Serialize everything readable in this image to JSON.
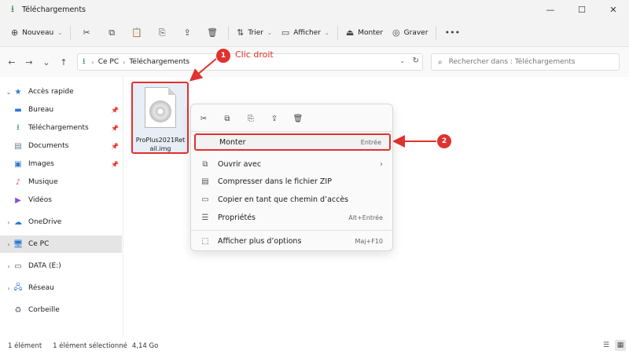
{
  "window": {
    "title": "Téléchargements"
  },
  "toolbar": {
    "new_label": "Nouveau",
    "sort_label": "Trier",
    "view_label": "Afficher",
    "mount_label": "Monter",
    "burn_label": "Graver"
  },
  "address": {
    "crumbs": [
      "Ce PC",
      "Téléchargements"
    ],
    "search_placeholder": "Rechercher dans : Téléchargements"
  },
  "sidebar": {
    "quick_access": "Accès rapide",
    "items": [
      "Bureau",
      "Téléchargements",
      "Documents",
      "Images",
      "Musique",
      "Vidéos"
    ],
    "onedrive": "OneDrive",
    "this_pc": "Ce PC",
    "data_drive": "DATA (E:)",
    "network": "Réseau",
    "recycle": "Corbeille"
  },
  "file": {
    "name": "ProPlus2021Retail.img"
  },
  "annotations": {
    "step1_number": "1",
    "step1_label": "Clic droit",
    "step2_number": "2"
  },
  "context_menu": {
    "items": [
      {
        "label": "Monter",
        "shortcut": "Entrée"
      },
      {
        "label": "Ouvrir avec",
        "shortcut": ""
      },
      {
        "label": "Compresser dans le fichier ZIP",
        "shortcut": ""
      },
      {
        "label": "Copier en tant que chemin d’accès",
        "shortcut": ""
      },
      {
        "label": "Propriétés",
        "shortcut": "Alt+Entrée"
      },
      {
        "label": "Afficher plus d’options",
        "shortcut": "Maj+F10"
      }
    ]
  },
  "status": {
    "count": "1 élément",
    "selected": "1 élément sélectionné",
    "size": "4,14 Go"
  },
  "colors": {
    "annotation_red": "#e0322f",
    "download_green": "#1f8a4c"
  }
}
